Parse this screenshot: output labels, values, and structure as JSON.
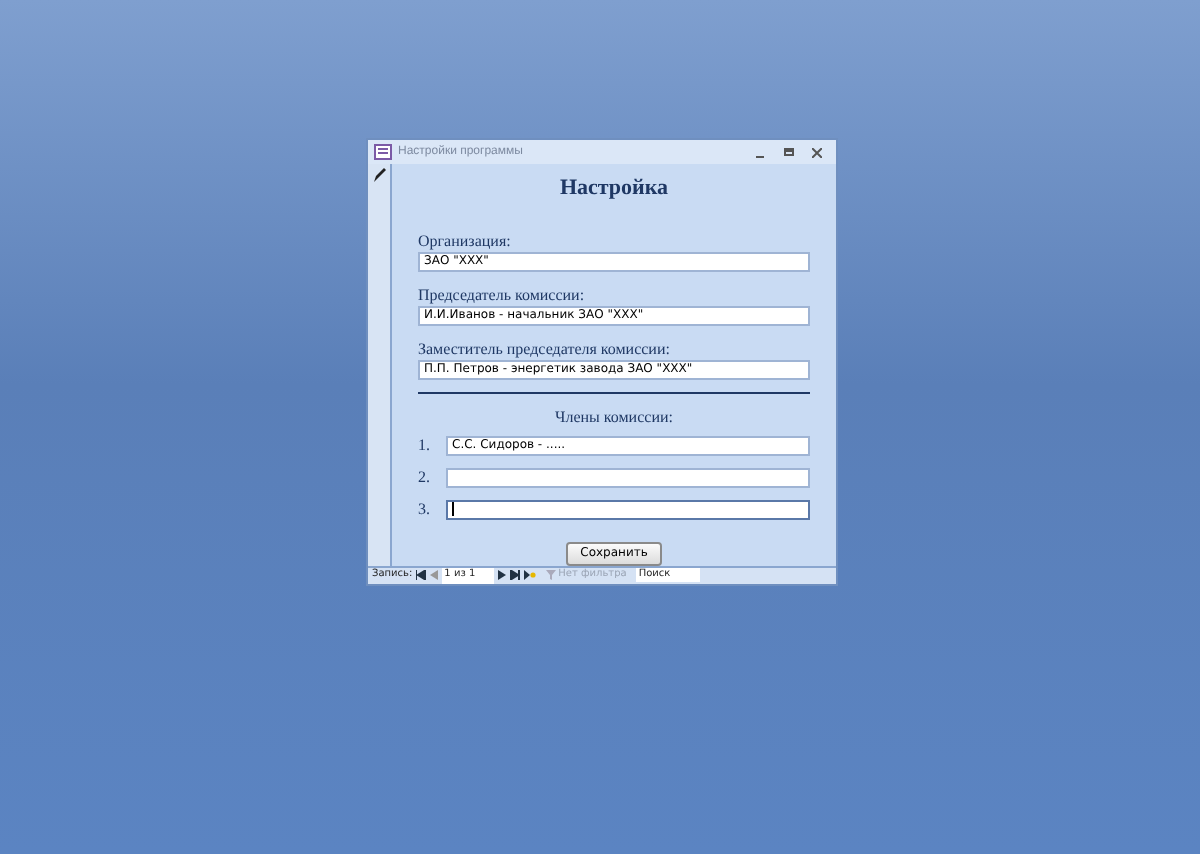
{
  "window": {
    "title": "Настройки программы"
  },
  "form": {
    "heading": "Настройка",
    "fields": [
      {
        "label": "Организация:",
        "value": "ЗАО \"ХХХ\""
      },
      {
        "label": "Председатель комиссии:",
        "value": "И.И.Иванов - начальник ЗАО \"ХХХ\""
      },
      {
        "label": "Заместитель председателя комиссии:",
        "value": "П.П. Петров - энергетик завода ЗАО \"ХХХ\""
      }
    ],
    "members_heading": "Члены комиссии:",
    "members": [
      {
        "number": "1.",
        "value": "С.С. Сидоров - .....",
        "focused": false
      },
      {
        "number": "2.",
        "focused": false
      },
      {
        "number": "3.",
        "focused": true
      }
    ],
    "save_button": "Сохранить"
  },
  "status_bar": {
    "record_label": "Запись:",
    "record_position": "1 из 1",
    "filter": "Нет фильтра",
    "search_placeholder": "Поиск"
  }
}
